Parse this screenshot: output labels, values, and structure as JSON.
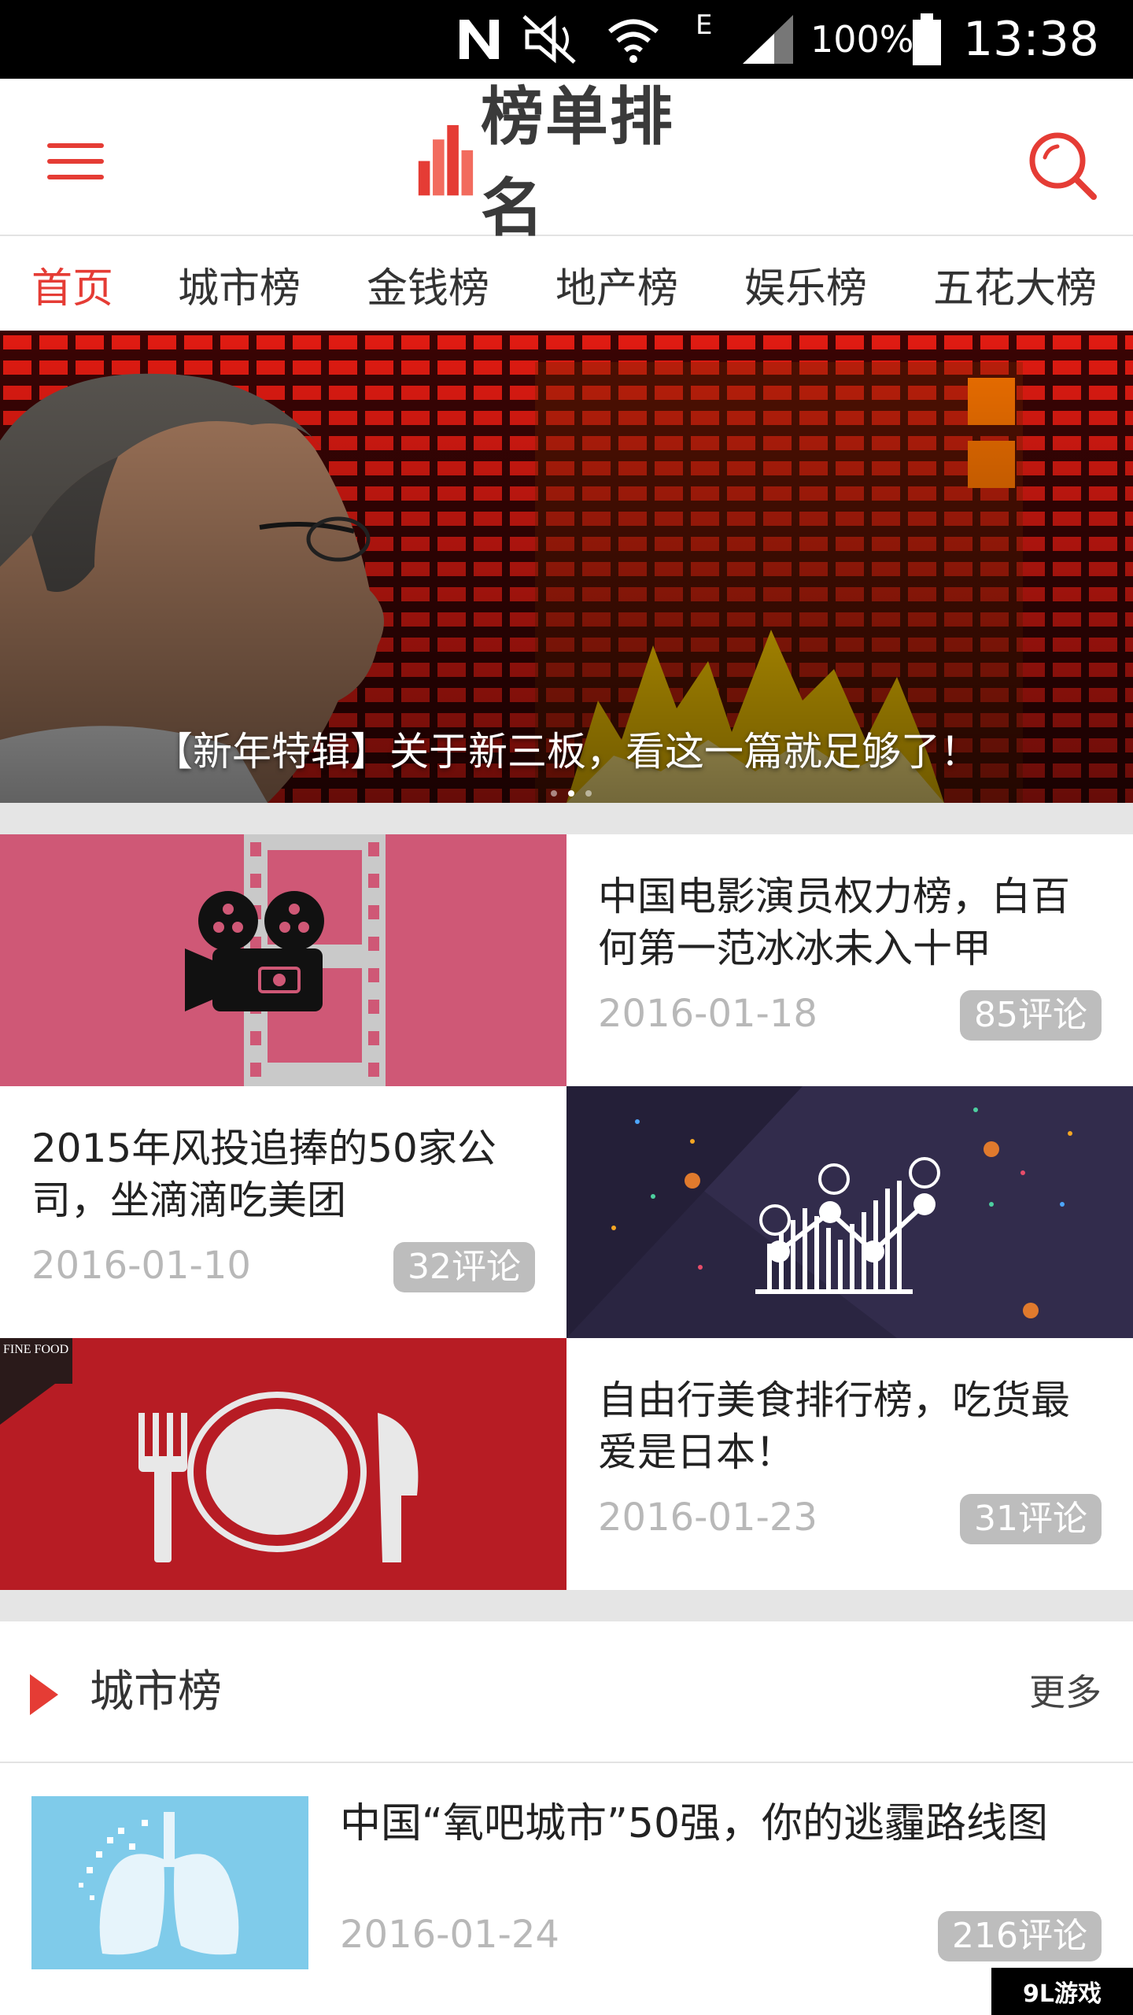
{
  "status_bar": {
    "battery_text": "100%",
    "time": "13:38",
    "network_label": "E"
  },
  "header": {
    "logo_text": "榜单排名",
    "brand_color": "#e53c35"
  },
  "tabs": [
    {
      "label": "首页",
      "active": true
    },
    {
      "label": "城市榜",
      "active": false
    },
    {
      "label": "金钱榜",
      "active": false
    },
    {
      "label": "地产榜",
      "active": false
    },
    {
      "label": "娱乐榜",
      "active": false
    },
    {
      "label": "五花大榜",
      "active": false
    }
  ],
  "hero": {
    "caption": "【新年特辑】关于新三板，看这一篇就足够了！"
  },
  "cards": [
    {
      "title": "中国电影演员权力榜，白百何第一范冰冰未入十甲",
      "date": "2016-01-18",
      "comments": "85评论",
      "icon": "film-camera-icon"
    },
    {
      "title": "2015年风投追捧的50家公司，坐滴滴吃美团",
      "date": "2016-01-10",
      "comments": "32评论",
      "icon": "money-chart-icon"
    },
    {
      "title": "自由行美食排行榜，吃货最爱是日本！",
      "date": "2016-01-23",
      "comments": "31评论",
      "icon": "plate-cutlery-icon",
      "img_label": "FINE FOOD"
    }
  ],
  "section": {
    "title": "城市榜",
    "more": "更多"
  },
  "list": [
    {
      "title": "中国“氧吧城市”50强，你的逃霾路线图",
      "date": "2016-01-24",
      "comments": "216评论",
      "icon": "lungs-icon"
    }
  ],
  "watermark": "9L游戏"
}
